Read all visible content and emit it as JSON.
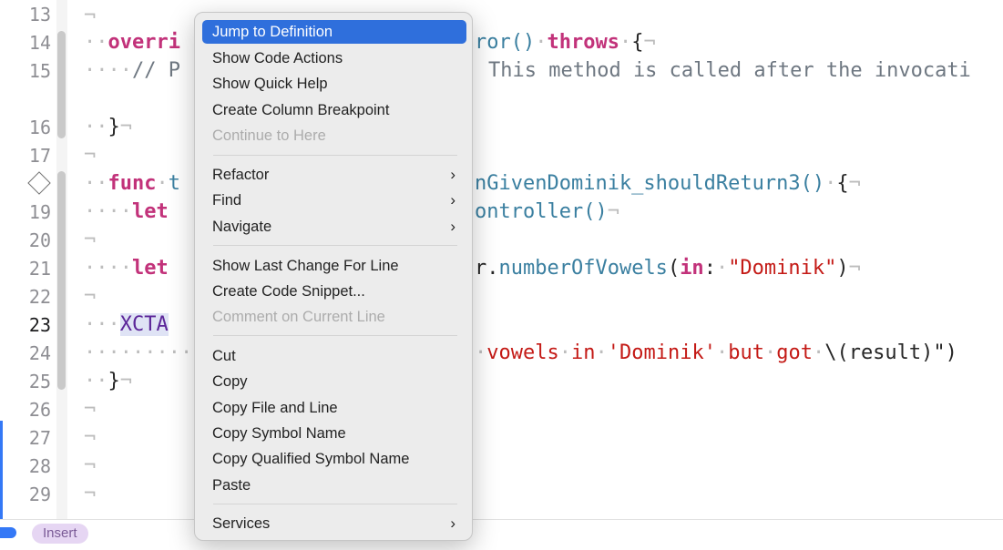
{
  "gutter": {
    "line_numbers": [
      "13",
      "14",
      "15",
      "16",
      "17",
      "19",
      "20",
      "21",
      "22",
      "23",
      "24",
      "25",
      "26",
      "27",
      "28",
      "29"
    ],
    "active_line": "23"
  },
  "code": {
    "line14_a": "overri",
    "line14_b": "ror()",
    "line14_c": "throws",
    "line14_d": "{",
    "line15_a": "// P",
    "line15_b": "This method is called after the invocati",
    "line16": "}",
    "line18_a": "func",
    "line18_b": "t",
    "line18_c": "nGivenDominik_shouldReturn3()",
    "line18_d": "{",
    "line19_a": "let",
    "line19_b": "ontroller()",
    "line21_a": "let",
    "line21_b": "r.",
    "line21_c": "numberOfVowels",
    "line21_d": "(",
    "line21_e": "in",
    "line21_f": ":",
    "line21_g": "\"Dominik\"",
    "line21_h": ")",
    "line23": "XCTA",
    "line24_a": "vowels",
    "line24_b": "in",
    "line24_c": "'Dominik'",
    "line24_d": "but",
    "line24_e": "got",
    "line24_f": "\\(result)\")",
    "line25": "}"
  },
  "context_menu": {
    "items": [
      {
        "label": "Jump to Definition",
        "selected": true
      },
      {
        "label": "Show Code Actions"
      },
      {
        "label": "Show Quick Help"
      },
      {
        "label": "Create Column Breakpoint"
      },
      {
        "label": "Continue to Here",
        "disabled": true
      },
      {
        "label": "Refactor",
        "submenu": true
      },
      {
        "label": "Find",
        "submenu": true
      },
      {
        "label": "Navigate",
        "submenu": true
      },
      {
        "label": "Show Last Change For Line"
      },
      {
        "label": "Create Code Snippet..."
      },
      {
        "label": "Comment on Current Line",
        "disabled": true
      },
      {
        "label": "Cut"
      },
      {
        "label": "Copy"
      },
      {
        "label": "Copy File and Line"
      },
      {
        "label": "Copy Symbol Name"
      },
      {
        "label": "Copy Qualified Symbol Name"
      },
      {
        "label": "Paste"
      },
      {
        "label": "Services",
        "submenu": true
      }
    ],
    "submenu_glyph": "›"
  },
  "statusbar": {
    "mode": "Insert"
  },
  "colors": {
    "accent": "#2f6fdc",
    "keyword": "#c2327a",
    "string": "#c41a16",
    "type": "#3a7fa0"
  },
  "icons": [
    "breakpoint-diamond-icon",
    "chevron-right-icon"
  ]
}
